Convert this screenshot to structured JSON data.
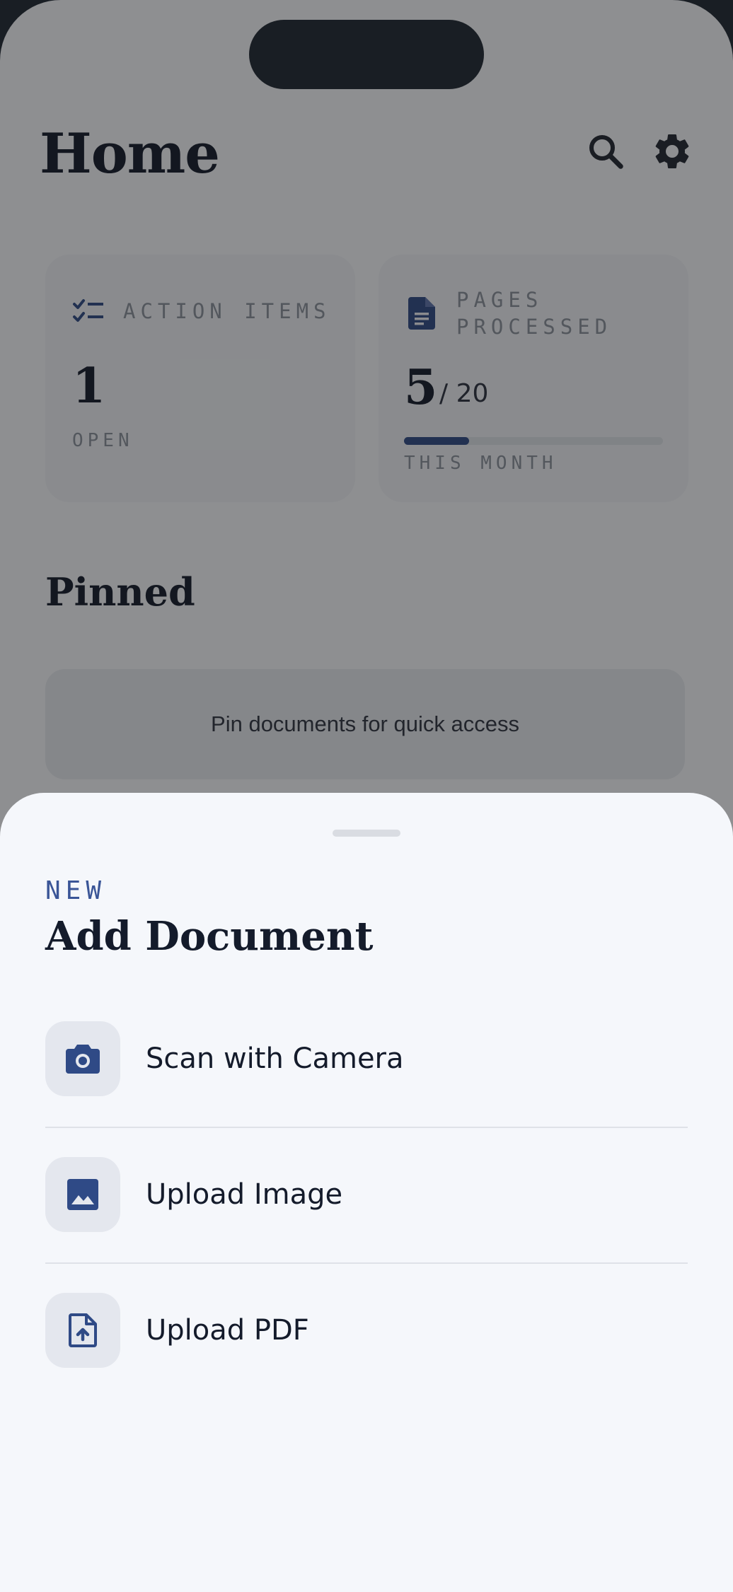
{
  "header": {
    "title": "Home"
  },
  "cards": {
    "action_items": {
      "label": "ACTION ITEMS",
      "count": "1",
      "sub": "OPEN"
    },
    "pages_processed": {
      "label_line1": "PAGES",
      "label_line2": "PROCESSED",
      "count": "5",
      "total": "/ 20",
      "progress": 0.25,
      "sub": "THIS MONTH"
    }
  },
  "pinned": {
    "title": "Pinned",
    "empty_text": "Pin documents for quick access"
  },
  "sheet": {
    "eyebrow": "NEW",
    "title": "Add Document",
    "options": [
      {
        "label": "Scan with Camera",
        "icon": "camera-icon"
      },
      {
        "label": "Upload Image",
        "icon": "image-icon"
      },
      {
        "label": "Upload PDF",
        "icon": "file-upload-icon"
      }
    ]
  },
  "colors": {
    "accent": "#2f4a86",
    "text": "#141b2b",
    "sheet_bg": "#f5f7fb",
    "overlay": "rgba(20,20,20,0.46)"
  }
}
